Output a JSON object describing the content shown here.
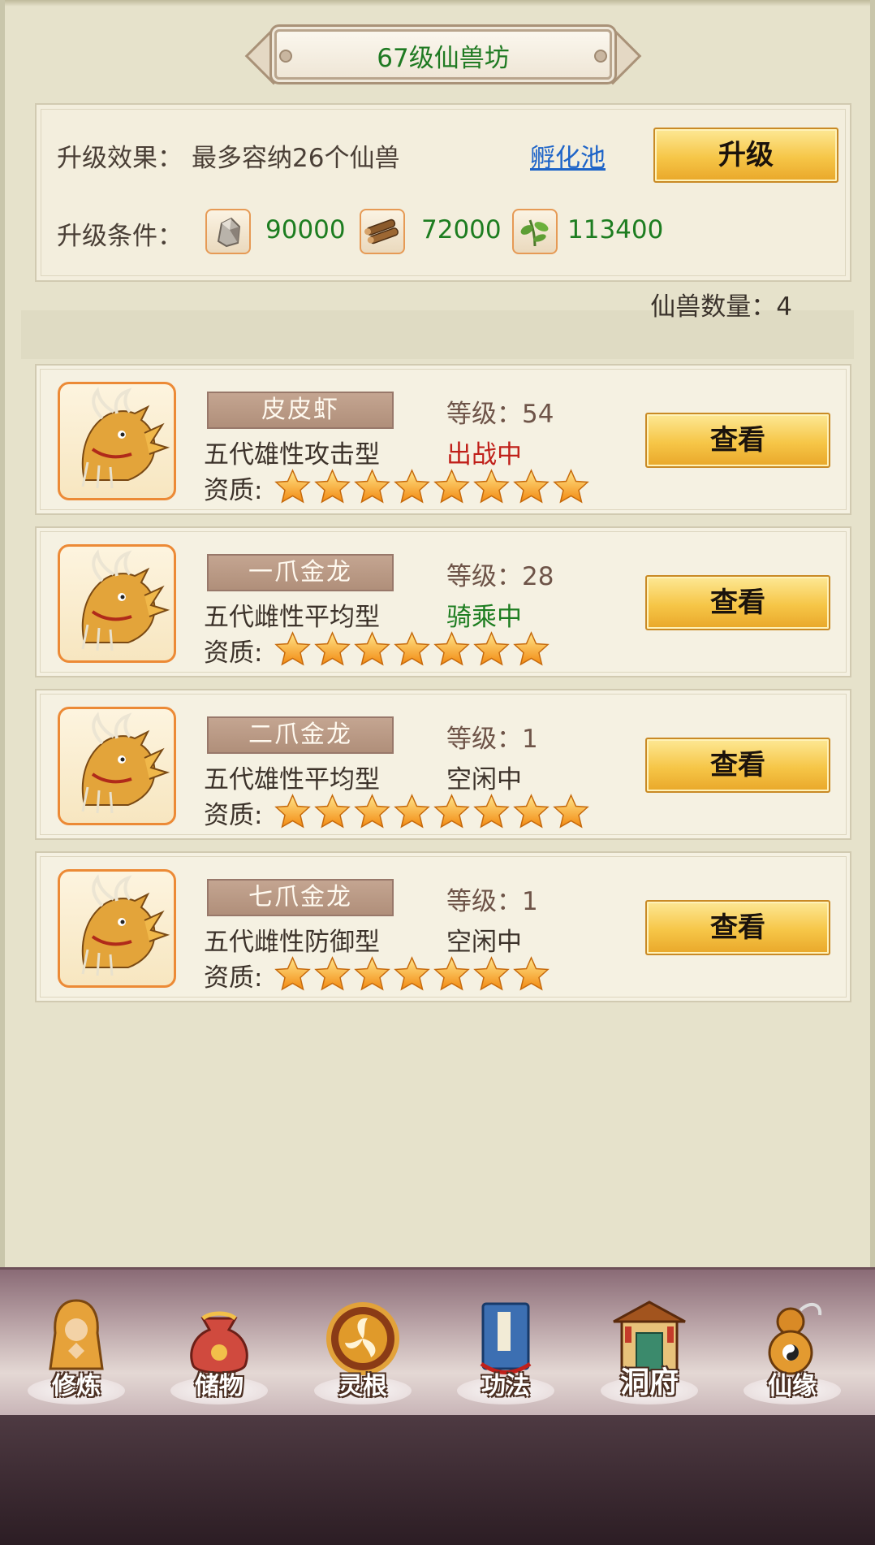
{
  "title": "67级仙兽坊",
  "upgrade": {
    "effect_label": "升级效果：",
    "effect_value": "最多容纳26个仙兽",
    "hatch_link": "孵化池",
    "upgrade_button": "升级",
    "cond_label": "升级条件：",
    "costs": [
      {
        "icon": "ore-icon",
        "value": "90000"
      },
      {
        "icon": "wood-icon",
        "value": "72000"
      },
      {
        "icon": "herb-icon",
        "value": "113400"
      }
    ]
  },
  "beast_count": "仙兽数量：4",
  "quality_label": "资质:",
  "view_button": "查看",
  "beasts": [
    {
      "name": "皮皮虾",
      "level": "等级：54",
      "desc": "五代雄性攻击型",
      "status": "出战中",
      "status_color": "#c0201a",
      "stars": 8
    },
    {
      "name": "一爪金龙",
      "level": "等级：28",
      "desc": "五代雌性平均型",
      "status": "骑乘中",
      "status_color": "#1d7d20",
      "stars": 7
    },
    {
      "name": "二爪金龙",
      "level": "等级：1",
      "desc": "五代雄性平均型",
      "status": "空闲中",
      "status_color": "#3c322a",
      "stars": 8
    },
    {
      "name": "七爪金龙",
      "level": "等级：1",
      "desc": "五代雌性防御型",
      "status": "空闲中",
      "status_color": "#3c322a",
      "stars": 7
    }
  ],
  "nav": [
    {
      "label": "修炼",
      "icon": "monk-icon"
    },
    {
      "label": "储物",
      "icon": "bag-icon"
    },
    {
      "label": "灵根",
      "icon": "triskelion-icon"
    },
    {
      "label": "功法",
      "icon": "book-icon"
    },
    {
      "label": "洞府",
      "icon": "palace-icon"
    },
    {
      "label": "仙缘",
      "icon": "gourd-icon"
    }
  ]
}
